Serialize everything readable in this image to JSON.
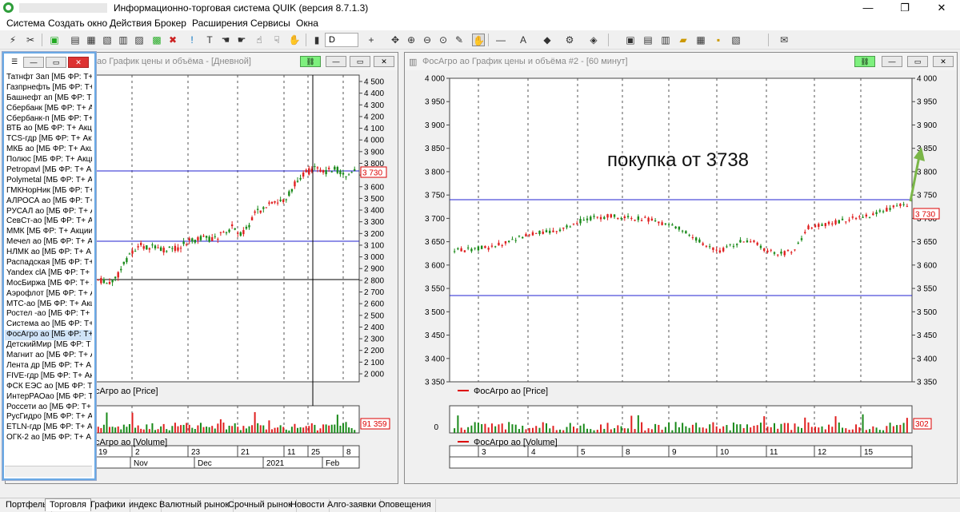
{
  "window": {
    "title": "Информационно-торговая система QUIK (версия 8.7.1.3)",
    "minimize_glyph": "—",
    "maximize_glyph": "❐",
    "close_glyph": "✕"
  },
  "menu": [
    "Система",
    "Создать окно",
    "Действия",
    "Брокер",
    "Расширения",
    "Сервисы",
    "Окна"
  ],
  "toolbar": {
    "interval_value": "D"
  },
  "chart_left": {
    "title": "ао График цены и объёма - [Дневной]",
    "price_panel_label": "сАгро ао [Price]",
    "volume_panel_label": "сАгро ао [Volume]",
    "last_price_label": "3 730",
    "last_volume_label": "91 359",
    "y_ticks": [
      "4 500",
      "4 400",
      "4 300",
      "4 200",
      "4 100",
      "4 000",
      "3 900",
      "3 800",
      "3 700",
      "3 600",
      "3 500",
      "3 400",
      "3 300",
      "3 200",
      "3 100",
      "3 000",
      "2 900",
      "2 800",
      "2 700",
      "2 600",
      "2 500",
      "2 400",
      "2 300",
      "2 200",
      "2 100",
      "2 000"
    ],
    "x_day_labels": [
      "19",
      "2",
      "23",
      "21",
      "11",
      "25",
      "8"
    ],
    "x_month_labels": [
      "Nov",
      "Dec",
      "2021",
      "Feb"
    ]
  },
  "chart_right": {
    "title": "ФосАгро ао График цены и объёма #2 - [60 минут]",
    "price_panel_label": "ФосАгро ао [Price]",
    "volume_panel_label": "ФосАгро ао [Volume]",
    "last_price_label": "3 730",
    "last_volume_label": "302",
    "volume_zero_label": "0",
    "annotation": "покупка от 3738",
    "y_ticks": [
      "4 000",
      "3 950",
      "3 900",
      "3 850",
      "3 800",
      "3 750",
      "3 700",
      "3 650",
      "3 600",
      "3 550",
      "3 500",
      "3 450",
      "3 400",
      "3 350"
    ],
    "x_day_labels": [
      "3",
      "4",
      "5",
      "8",
      "9",
      "10",
      "11",
      "12",
      "15"
    ]
  },
  "instrument_list": [
    "Татнфт Зап [МБ ФР: Т+",
    "Газпрнефть [МБ ФР: Т+",
    "Башнефт ап [МБ ФР: Т+",
    "Сбербанк [МБ ФР: Т+ А",
    "Сбербанк-п [МБ ФР: Т+",
    "ВТБ ао [МБ ФР: Т+ Акц",
    "TCS-гдр [МБ ФР: Т+ Акц",
    "МКБ ао [МБ ФР: Т+ Акц",
    "Полюс [МБ ФР: Т+ Акци",
    "Petropavl [МБ ФР: Т+ Ак",
    "Polymetal [МБ ФР: Т+ Ак",
    "ГМКНорНик [МБ ФР: Т+",
    "АЛРОСА ао [МБ ФР: Т+",
    "РУСАЛ ао [МБ ФР: Т+ А",
    "СевСт-ао [МБ ФР: Т+ А",
    "ММК [МБ ФР: Т+ Акции",
    "Мечел ао [МБ ФР: Т+ А",
    "НЛМК ао [МБ ФР: Т+ А",
    "Распадская [МБ ФР: Т+",
    "Yandex clA [МБ ФР: Т+",
    "МосБиржа [МБ ФР: Т+ А",
    "Аэрофлот [МБ ФР: Т+ А",
    "МТС-ао [МБ ФР: Т+ Акц",
    "Ростел -ао [МБ ФР: Т+",
    "Система ао [МБ ФР: Т+",
    "ФосАгро ао [МБ ФР: Т+",
    "ДетскийМир [МБ ФР: Т",
    "Магнит ао [МБ ФР: Т+ А",
    "Лента др [МБ ФР: Т+ А",
    "FIVE-гдр [МБ ФР: Т+ Ак",
    "ФСК ЕЭС ао [МБ ФР: Т",
    "ИнтерРАОао [МБ ФР: Т",
    "Россети ао [МБ ФР: Т+",
    "РусГидро [МБ ФР: Т+ А",
    "ETLN-гдр [МБ ФР: Т+ А",
    "ОГК-2 ао [МБ ФР: Т+ А"
  ],
  "instrument_selected": "ФосАгро ао [МБ ФР: Т+",
  "tabs": [
    "Портфель",
    "Торговля",
    "Графики",
    "индекс",
    "Валютный рынок",
    "Срочный рынок",
    "Новости",
    "Алго-заявки",
    "Оповещения"
  ],
  "active_tab": "Торговля",
  "colors": {
    "up": "#1a8a1a",
    "down": "#e02020",
    "level_line": "#2020d0",
    "accent_green": "#7ef07e"
  }
}
